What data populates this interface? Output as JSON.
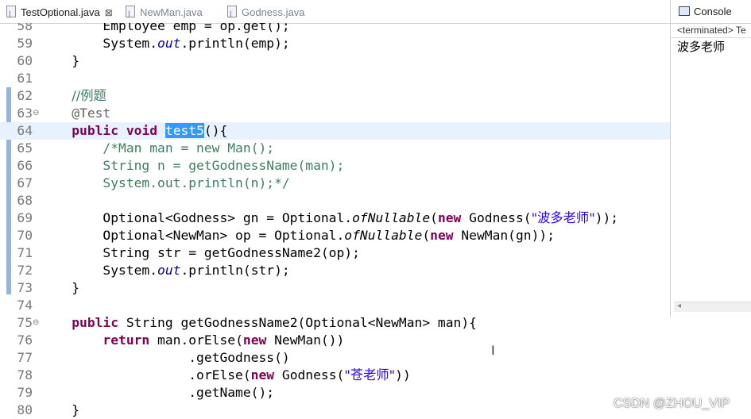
{
  "tabs": [
    {
      "label": "TestOptional.java",
      "close": "⊠",
      "active": true
    },
    {
      "label": "NewMan.java",
      "active": false
    },
    {
      "label": "Godness.java",
      "active": false
    }
  ],
  "console": {
    "title": "Console",
    "terminated": "<terminated> Te",
    "output": "波多老师"
  },
  "editor": {
    "lines": [
      {
        "n": "58",
        "t": [
          [
            "",
            "        "
          ],
          [
            "",
            "Employee emp = op.get();"
          ]
        ]
      },
      {
        "n": "59",
        "t": [
          [
            "",
            "        System."
          ],
          [
            "fld",
            "out"
          ],
          [
            "",
            ".println(emp);"
          ]
        ]
      },
      {
        "n": "60",
        "t": [
          [
            "",
            "    }"
          ]
        ]
      },
      {
        "n": "61",
        "t": [
          [
            "",
            ""
          ]
        ]
      },
      {
        "n": "62",
        "t": [
          [
            "",
            "    "
          ],
          [
            "cm",
            "//例题"
          ]
        ]
      },
      {
        "n": "63",
        "fold": "⊖",
        "t": [
          [
            "",
            "    "
          ],
          [
            "ann",
            "@Test"
          ]
        ]
      },
      {
        "n": "64",
        "current": true,
        "t": [
          [
            "",
            "    "
          ],
          [
            "kw",
            "public"
          ],
          [
            "",
            " "
          ],
          [
            "kw",
            "void"
          ],
          [
            "",
            " "
          ],
          [
            "sel",
            "test5"
          ],
          [
            "",
            "(){"
          ]
        ]
      },
      {
        "n": "65",
        "t": [
          [
            "",
            "        "
          ],
          [
            "cm",
            "/*Man man = new Man();"
          ]
        ]
      },
      {
        "n": "66",
        "t": [
          [
            "",
            "        "
          ],
          [
            "cm",
            "String n = getGodnessName(man);"
          ]
        ]
      },
      {
        "n": "67",
        "t": [
          [
            "",
            "        "
          ],
          [
            "cm",
            "System.out.println(n);*/"
          ]
        ]
      },
      {
        "n": "68",
        "t": [
          [
            "",
            ""
          ]
        ]
      },
      {
        "n": "69",
        "t": [
          [
            "",
            "        Optional<Godness> gn = Optional."
          ],
          [
            "mi",
            "ofNullable"
          ],
          [
            "",
            "("
          ],
          [
            "kw",
            "new"
          ],
          [
            "",
            " Godness("
          ],
          [
            "st",
            "\"波多老师\""
          ],
          [
            "",
            "));"
          ]
        ]
      },
      {
        "n": "70",
        "t": [
          [
            "",
            "        Optional<NewMan> op = Optional."
          ],
          [
            "mi",
            "ofNullable"
          ],
          [
            "",
            "("
          ],
          [
            "kw",
            "new"
          ],
          [
            "",
            " NewMan(gn));"
          ]
        ]
      },
      {
        "n": "71",
        "t": [
          [
            "",
            "        String str = getGodnessName2(op);"
          ]
        ]
      },
      {
        "n": "72",
        "t": [
          [
            "",
            "        System."
          ],
          [
            "fld",
            "out"
          ],
          [
            "",
            ".println(str);"
          ]
        ]
      },
      {
        "n": "73",
        "t": [
          [
            "",
            "    }"
          ]
        ]
      },
      {
        "n": "74",
        "t": [
          [
            "",
            ""
          ]
        ]
      },
      {
        "n": "75",
        "fold": "⊖",
        "t": [
          [
            "",
            "    "
          ],
          [
            "kw",
            "public"
          ],
          [
            "",
            " String getGodnessName2(Optional<NewMan> man){"
          ]
        ]
      },
      {
        "n": "76",
        "t": [
          [
            "",
            "        "
          ],
          [
            "kw",
            "return"
          ],
          [
            "",
            " man.orElse("
          ],
          [
            "kw",
            "new"
          ],
          [
            "",
            " NewMan())"
          ]
        ]
      },
      {
        "n": "77",
        "t": [
          [
            "",
            "                   .getGodness()"
          ]
        ]
      },
      {
        "n": "78",
        "t": [
          [
            "",
            "                   .orElse("
          ],
          [
            "kw",
            "new"
          ],
          [
            "",
            " Godness("
          ],
          [
            "st",
            "\"苍老师\""
          ],
          [
            "",
            "))"
          ]
        ]
      },
      {
        "n": "79",
        "t": [
          [
            "",
            "                   .getName();"
          ]
        ]
      },
      {
        "n": "80",
        "t": [
          [
            "",
            "    }"
          ]
        ]
      }
    ]
  },
  "watermark": "CSDN @ZHOU_VIP",
  "colors": {
    "keyword": "#7f0055",
    "comment": "#3f7f5f",
    "string": "#2a00ff",
    "field": "#0000c0",
    "selection": "#3399ff",
    "current_line": "#e8f2fe"
  }
}
